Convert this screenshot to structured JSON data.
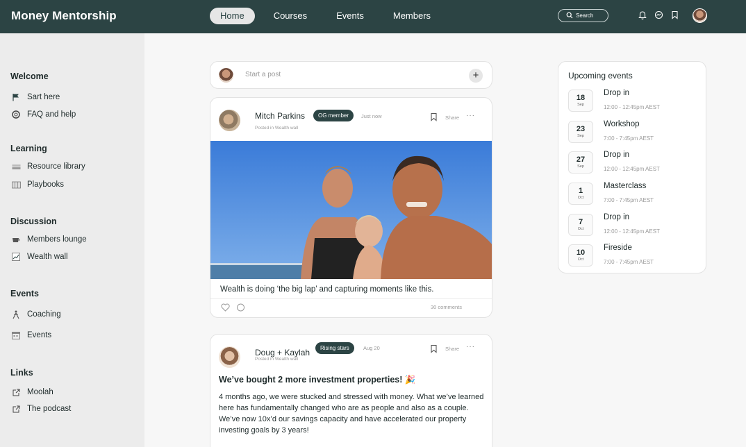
{
  "header": {
    "brand": "Money Mentorship",
    "nav": [
      "Home",
      "Courses",
      "Events",
      "Members"
    ],
    "active_nav": "Home",
    "search_label": "Search"
  },
  "sidebar": {
    "sections": [
      {
        "title": "Welcome",
        "items": [
          {
            "label": "Sart here",
            "icon": "flag-icon"
          },
          {
            "label": "FAQ and help",
            "icon": "lifebuoy-icon"
          }
        ]
      },
      {
        "title": "Learning",
        "items": [
          {
            "label": "Resource library",
            "icon": "books-icon"
          },
          {
            "label": "Playbooks",
            "icon": "map-icon"
          }
        ]
      },
      {
        "title": "Discussion",
        "items": [
          {
            "label": "Members lounge",
            "icon": "coffee-icon"
          },
          {
            "label": "Wealth wall",
            "icon": "chart-icon"
          }
        ]
      },
      {
        "title": "Events",
        "items": [
          {
            "label": "Coaching",
            "icon": "climber-icon"
          },
          {
            "label": "Events",
            "icon": "calendar-icon"
          }
        ]
      },
      {
        "title": "Links",
        "items": [
          {
            "label": "Moolah",
            "icon": "external-link-icon"
          },
          {
            "label": "The podcast",
            "icon": "external-link-icon"
          }
        ]
      }
    ]
  },
  "composer": {
    "placeholder": "Start a post"
  },
  "posts": [
    {
      "author": "Mitch Parkins",
      "badge": "OG member",
      "time": "Just now",
      "posted_in": "Posted in Wealth wall",
      "share": "Share",
      "caption": "Wealth is doing ‘the big lap’ and capturing moments like this.",
      "comments": "30 comments"
    },
    {
      "author": "Doug + Kaylah",
      "badge": "Rising stars",
      "time": "Aug 20",
      "posted_in": "Posted in Wealth wall",
      "share": "Share",
      "title": "We’ve bought 2 more investment properties! 🎉",
      "body": "4 months ago, we were stucked and stressed with money. What we’ve learned here has fundamentally changed who are as people and also as a couple. We’ve now 10x’d our savings capacity and have accelerated our property investing goals by 3 years!"
    }
  ],
  "events": {
    "title": "Upcoming events",
    "items": [
      {
        "day": "18",
        "month": "Sep",
        "name": "Drop in",
        "time": "12:00 - 12:45pm AEST"
      },
      {
        "day": "23",
        "month": "Sep",
        "name": "Workshop",
        "time": "7:00 - 7:45pm AEST"
      },
      {
        "day": "27",
        "month": "Sep",
        "name": "Drop in",
        "time": "12:00 - 12:45pm AEST"
      },
      {
        "day": "1",
        "month": "Oct",
        "name": "Masterclass",
        "time": "7:00 - 7:45pm AEST"
      },
      {
        "day": "7",
        "month": "Oct",
        "name": "Drop in",
        "time": "12:00 - 12:45pm AEST"
      },
      {
        "day": "10",
        "month": "Oct",
        "name": "Fireside",
        "time": "7:00 - 7:45pm AEST"
      }
    ]
  },
  "colors": {
    "header_bg": "#2c4444",
    "badge_bg": "#2c4444",
    "sidebar_bg": "#ececec",
    "page_bg": "#f7f7f7"
  }
}
